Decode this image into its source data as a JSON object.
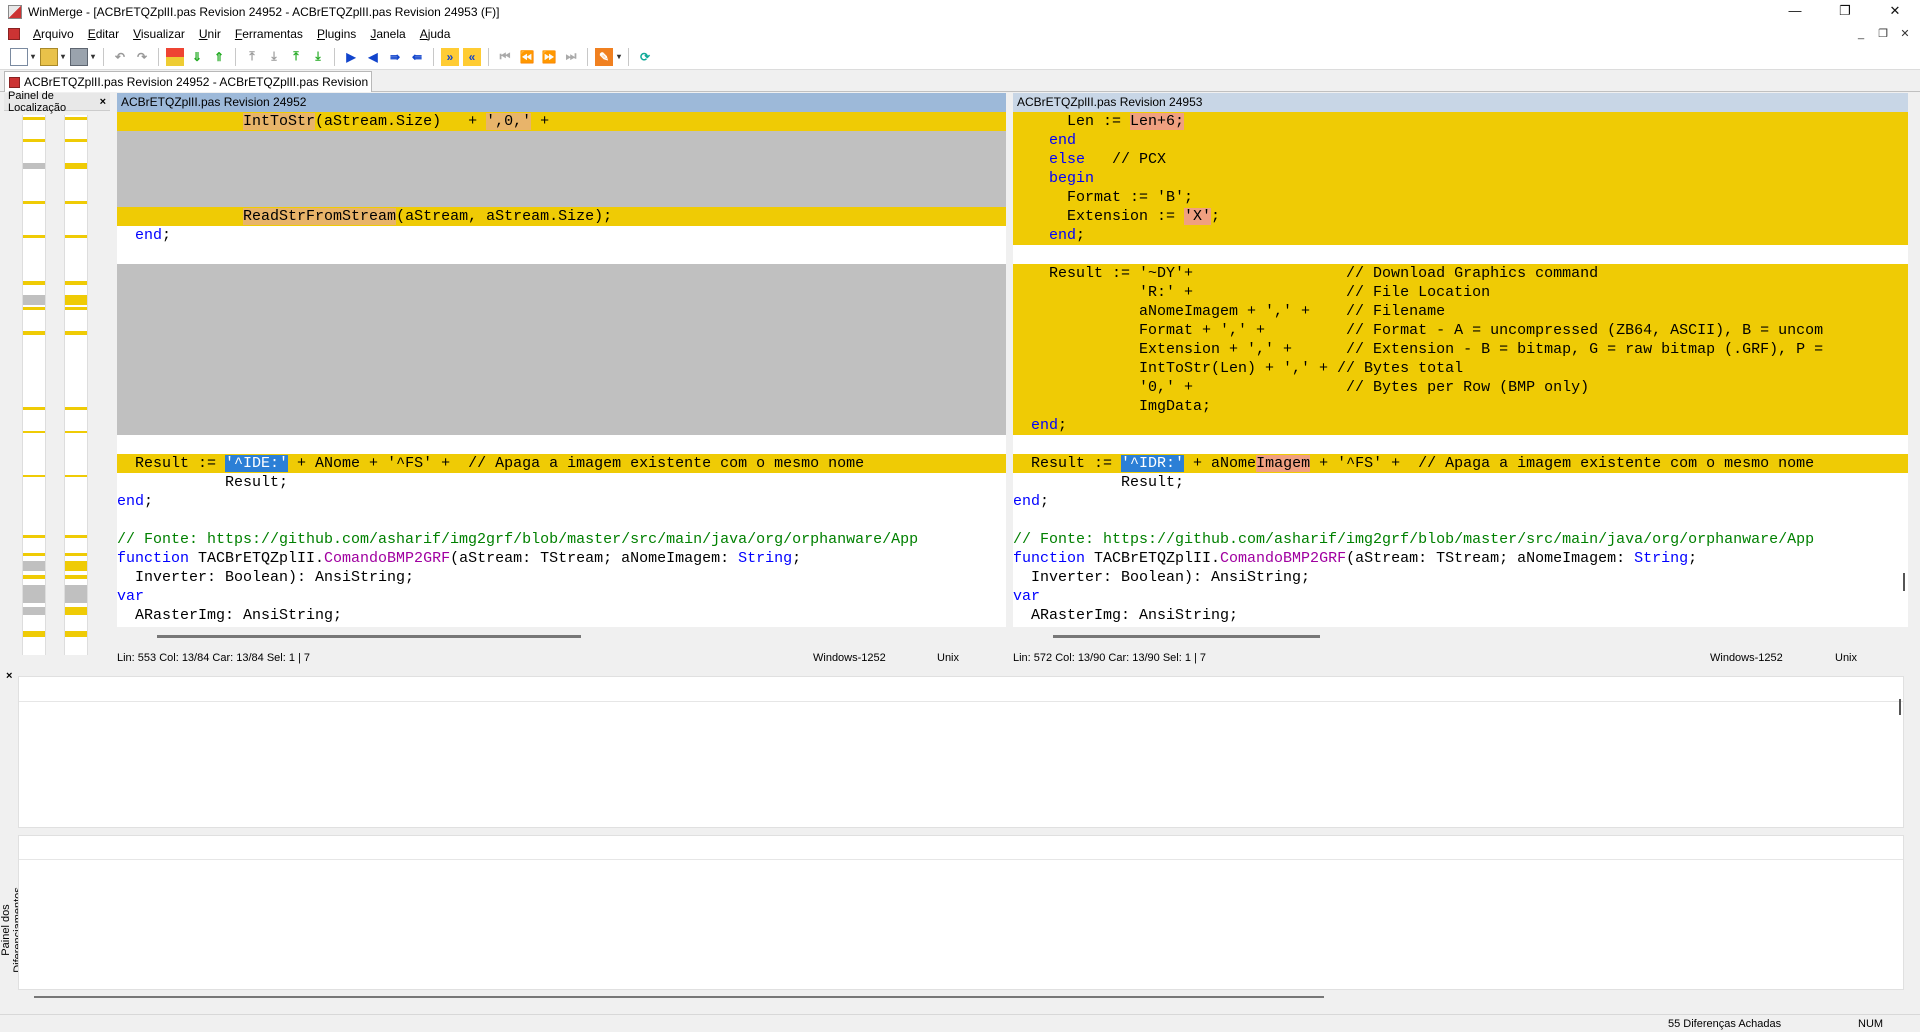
{
  "window": {
    "title": "WinMerge - [ACBrETQZplII.pas Revision 24952 - ACBrETQZplII.pas Revision 24953 (F)]",
    "controls": {
      "minimize": "—",
      "maximize": "❐",
      "close": "✕"
    }
  },
  "menu": {
    "items": [
      "Arquivo",
      "Editar",
      "Visualizar",
      "Unir",
      "Ferramentas",
      "Plugins",
      "Janela",
      "Ajuda"
    ],
    "mdi_controls": [
      "_",
      "❐",
      "✕"
    ]
  },
  "tab": {
    "label": "ACBrETQZplII.pas Revision 24952 - ACBrETQZplII.pas Revision 2..."
  },
  "location_pane": {
    "title": "Painel de Localização",
    "close": "×"
  },
  "colors": {
    "diff": "#efcb05",
    "gap": "#c0c0c0",
    "selection": "#2b7fd6",
    "keyword": "#0000ff",
    "comment": "#008000"
  },
  "left_pane": {
    "header": "ACBrETQZplII.pas Revision 24952",
    "status": {
      "position": "Lin: 553  Col: 13/84  Car: 13/84  Sel: 1 | 7",
      "encoding": "Windows-1252",
      "eol": "Unix"
    },
    "lines": [
      "              IntToStr(aStream.Size)   + ',0,' +",
      "",
      "",
      "",
      "",
      "              ReadStrFromStream(aStream, aStream.Size);",
      "  end;",
      "",
      "",
      "",
      "",
      "",
      "",
      "",
      "",
      "",
      "",
      "",
      "  Result := '^IDE:' + ANome + '^FS' +  // Apaga a imagem existente com o mesmo nome",
      "            Result;",
      "end;",
      "",
      "// Fonte: https://github.com/asharif/img2grf/blob/master/src/main/java/org/orphanware/App",
      "function TACBrETQZplII.ComandoBMP2GRF(aStream: TStream; aNomeImagem: String;",
      "  Inverter: Boolean): AnsiString;",
      "var",
      "  ARasterImg: AnsiString;"
    ]
  },
  "right_pane": {
    "header": "ACBrETQZplII.pas Revision 24953",
    "status": {
      "position": "Lin: 572  Col: 13/90  Car: 13/90  Sel: 1 | 7",
      "encoding": "Windows-1252",
      "eol": "Unix"
    },
    "lines": [
      "      Len := Len+6;",
      "    end",
      "    else   // PCX",
      "    begin",
      "      Format := 'B';",
      "      Extension := 'X';",
      "    end;",
      "",
      "    Result := '~DY'+                 // Download Graphics command",
      "              'R:' +                 // File Location",
      "              aNomeImagem + ',' +    // Filename",
      "              Format + ',' +         // Format - A = uncompressed (ZB64, ASCII), B = uncom",
      "              Extension + ',' +      // Extension - B = bitmap, G = raw bitmap (.GRF), P =",
      "              IntToStr(Len) + ',' + // Bytes total",
      "              '0,' +                 // Bytes per Row (BMP only)",
      "              ImgData;",
      "  end;",
      "",
      "  Result := '^IDR:' + aNomeImagem + '^FS' +  // Apaga a imagem existente com o mesmo nome",
      "            Result;",
      "end;",
      "",
      "// Fonte: https://github.com/asharif/img2grf/blob/master/src/main/java/org/orphanware/App",
      "function TACBrETQZplII.ComandoBMP2GRF(aStream: TStream; aNomeImagem: String;",
      "  Inverter: Boolean): AnsiString;",
      "var",
      "  ARasterImg: AnsiString;"
    ]
  },
  "diff_pane": {
    "title": "Painel dos Diferenciamentos",
    "close": "×"
  },
  "statusbar": {
    "differences": "55 Diferenças Achadas",
    "num": "NUM"
  }
}
